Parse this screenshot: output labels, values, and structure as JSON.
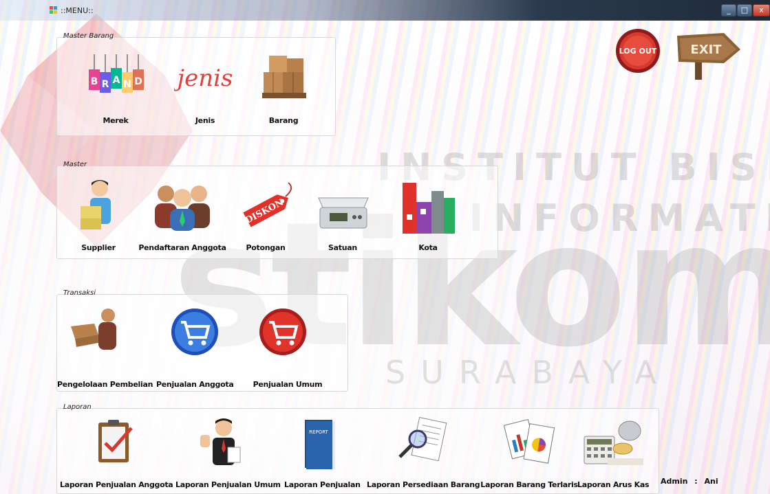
{
  "window": {
    "title": "::MENU::",
    "controls": [
      "_",
      "□",
      "x"
    ]
  },
  "watermark": {
    "line1": "INSTITUT BISNIS",
    "line2": "& INFORMATIKA",
    "brand": "stikom",
    "city": "SURABAYA"
  },
  "top_buttons": {
    "logout_label": "LOG OUT",
    "exit_label": "EXIT"
  },
  "master_barang": {
    "legend": "Master Barang",
    "items": [
      {
        "label": "Merek",
        "icon": "brand-tags-icon"
      },
      {
        "label": "Jenis",
        "icon": "jenis-script-icon"
      },
      {
        "label": "Barang",
        "icon": "boxes-pallet-icon"
      }
    ]
  },
  "master": {
    "legend": "Master",
    "items": [
      {
        "label": "Supplier",
        "icon": "supplier-boxes-icon"
      },
      {
        "label": "Pendaftaran Anggota",
        "icon": "people-group-icon"
      },
      {
        "label": "Potongan",
        "icon": "diskon-tag-icon"
      },
      {
        "label": "Satuan",
        "icon": "scale-icon"
      },
      {
        "label": "Kota",
        "icon": "city-buildings-icon"
      }
    ]
  },
  "transaksi": {
    "legend": "Transaksi",
    "items": [
      {
        "label": "Pengelolaan Pembelian",
        "icon": "delivery-man-icon"
      },
      {
        "label": "Penjualan Anggota",
        "icon": "blue-cart-icon"
      },
      {
        "label": "Penjualan Umum",
        "icon": "red-cart-icon"
      }
    ]
  },
  "laporan": {
    "legend": "Laporan",
    "items": [
      {
        "label": "Laporan Penjualan Anggota",
        "icon": "clipboard-check-icon"
      },
      {
        "label": "Laporan Penjualan Umum",
        "icon": "businessman-thumbs-up-icon"
      },
      {
        "label": "Laporan Penjualan",
        "icon": "report-book-icon"
      },
      {
        "label": "Laporan Persediaan Barang",
        "icon": "magnifier-document-icon"
      },
      {
        "label": "Laporan Barang Terlaris",
        "icon": "charts-documents-icon"
      },
      {
        "label": "Laporan Arus Kas",
        "icon": "calculator-coins-icon"
      }
    ]
  },
  "status": {
    "role": "Admin",
    "separator": ":",
    "user": "Ani"
  }
}
